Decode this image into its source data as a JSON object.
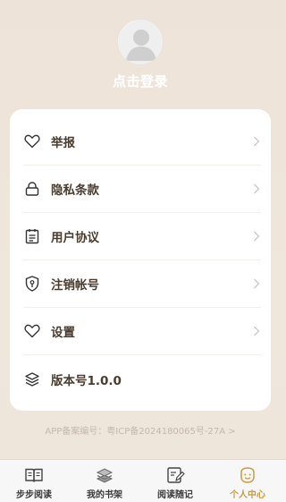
{
  "profile": {
    "login_label": "点击登录"
  },
  "menu": {
    "items": [
      {
        "label": "举报",
        "icon": "heart-icon"
      },
      {
        "label": "隐私条款",
        "icon": "lock-icon"
      },
      {
        "label": "用户协议",
        "icon": "clipboard-icon"
      },
      {
        "label": "注销帐号",
        "icon": "shield-icon"
      },
      {
        "label": "设置",
        "icon": "heart-icon"
      },
      {
        "label": "版本号1.0.0",
        "icon": "layers-icon"
      }
    ]
  },
  "footer": {
    "icp_text": "APP备案编号：粤ICP备2024180065号-27A >"
  },
  "tabbar": {
    "tabs": [
      {
        "label": "步步阅读",
        "icon": "book-icon"
      },
      {
        "label": "我的书架",
        "icon": "bookshelf-icon"
      },
      {
        "label": "阅读随记",
        "icon": "notes-icon"
      },
      {
        "label": "个人中心",
        "icon": "smiley-icon",
        "active": true
      }
    ]
  },
  "colors": {
    "background": "#eee4d9",
    "accent": "#c99a45",
    "menu_text": "#4a3c2e"
  }
}
